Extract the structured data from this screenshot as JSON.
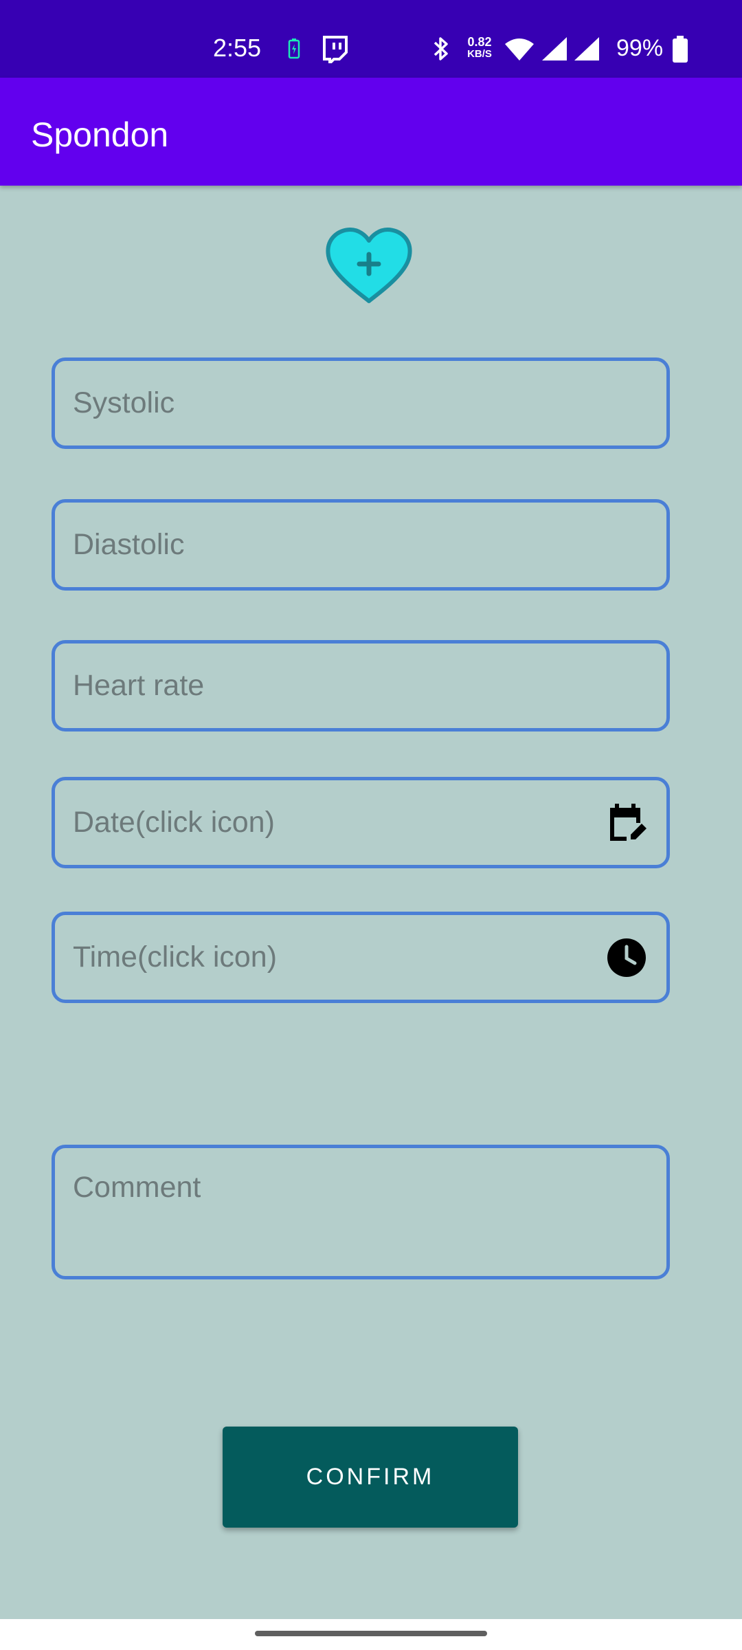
{
  "status_bar": {
    "time": "2:55",
    "net_speed_value": "0.82",
    "net_speed_unit": "KB/S",
    "battery_percent": "99%"
  },
  "app_bar": {
    "title": "Spondon"
  },
  "logo": {
    "icon": "heart-plus-icon",
    "color": "#22dde6"
  },
  "form": {
    "systolic_placeholder": "Systolic",
    "diastolic_placeholder": "Diastolic",
    "heart_rate_placeholder": "Heart rate",
    "date_placeholder": "Date(click icon)",
    "time_placeholder": "Time(click icon)",
    "comment_placeholder": "Comment",
    "field_border_color": "#4a7fd6"
  },
  "confirm_button": {
    "label": "CONFIRM",
    "color": "#045b5c"
  },
  "colors": {
    "status_bar": "#3700b3",
    "app_bar": "#6200ee",
    "background": "#b4cecb"
  }
}
